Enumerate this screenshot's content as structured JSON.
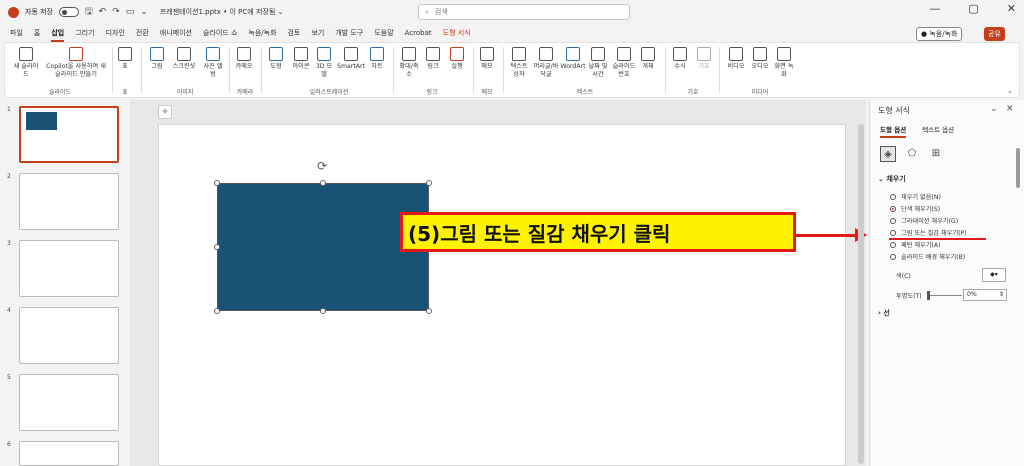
{
  "title_bar": {
    "autosave_label": "자동 저장",
    "toggle_state": "끔",
    "doc_title": "프레젠테이션1.pptx • 이 PC에 저장됨 ⌄",
    "search_placeholder": "검색"
  },
  "menu": [
    "파일",
    "홈",
    "삽입",
    "그리기",
    "디자인",
    "전환",
    "애니메이션",
    "슬라이드 쇼",
    "녹음/녹화",
    "검토",
    "보기",
    "개발 도구",
    "도움말",
    "Acrobat",
    "도형 서식"
  ],
  "record_label": "● 녹음/녹화",
  "share_label": "공유",
  "ribbon": {
    "buttons": [
      "새 슬라이드",
      "Copilot을 사용하여 새 슬라이드 만들기",
      "표",
      "그림",
      "스크린샷",
      "사진 앨범",
      "카메오",
      "도형",
      "아이콘",
      "3D 모델",
      "SmartArt",
      "차트",
      "확대/축소",
      "링크",
      "실행",
      "메모",
      "텍스트 상자",
      "머리글/바닥글",
      "WordArt",
      "날짜 및 시간",
      "슬라이드 번호",
      "개체",
      "수식",
      "기호",
      "비디오",
      "오디오",
      "화면 녹화"
    ],
    "groups": [
      "슬라이드",
      "표",
      "이미지",
      "카메라",
      "일러스트레이션",
      "링크",
      "메모",
      "텍스트",
      "기호",
      "미디어"
    ]
  },
  "slides": [
    "1",
    "2",
    "3",
    "4",
    "5",
    "6"
  ],
  "callout_text": "(5)그림 또는 질감 채우기 클릭",
  "pane": {
    "title": "도형 서식",
    "tabs": [
      "도형 옵션",
      "텍스트 옵션"
    ],
    "section_fill": "채우기",
    "fill_options": [
      "채우기 없음(N)",
      "단색 채우기(S)",
      "그라데이션 채우기(G)",
      "그림 또는 질감 채우기(P)",
      "패턴 채우기(A)",
      "슬라이드 배경 채우기(B)"
    ],
    "color_label": "색(C)",
    "transparency_label": "투명도(T)",
    "transparency_value": "0%",
    "section_line": "선"
  },
  "colors": {
    "accent": "#c43e1c",
    "shape_fill": "#1a5276",
    "callout_bg": "#fff200",
    "callout_border": "#e31818"
  }
}
